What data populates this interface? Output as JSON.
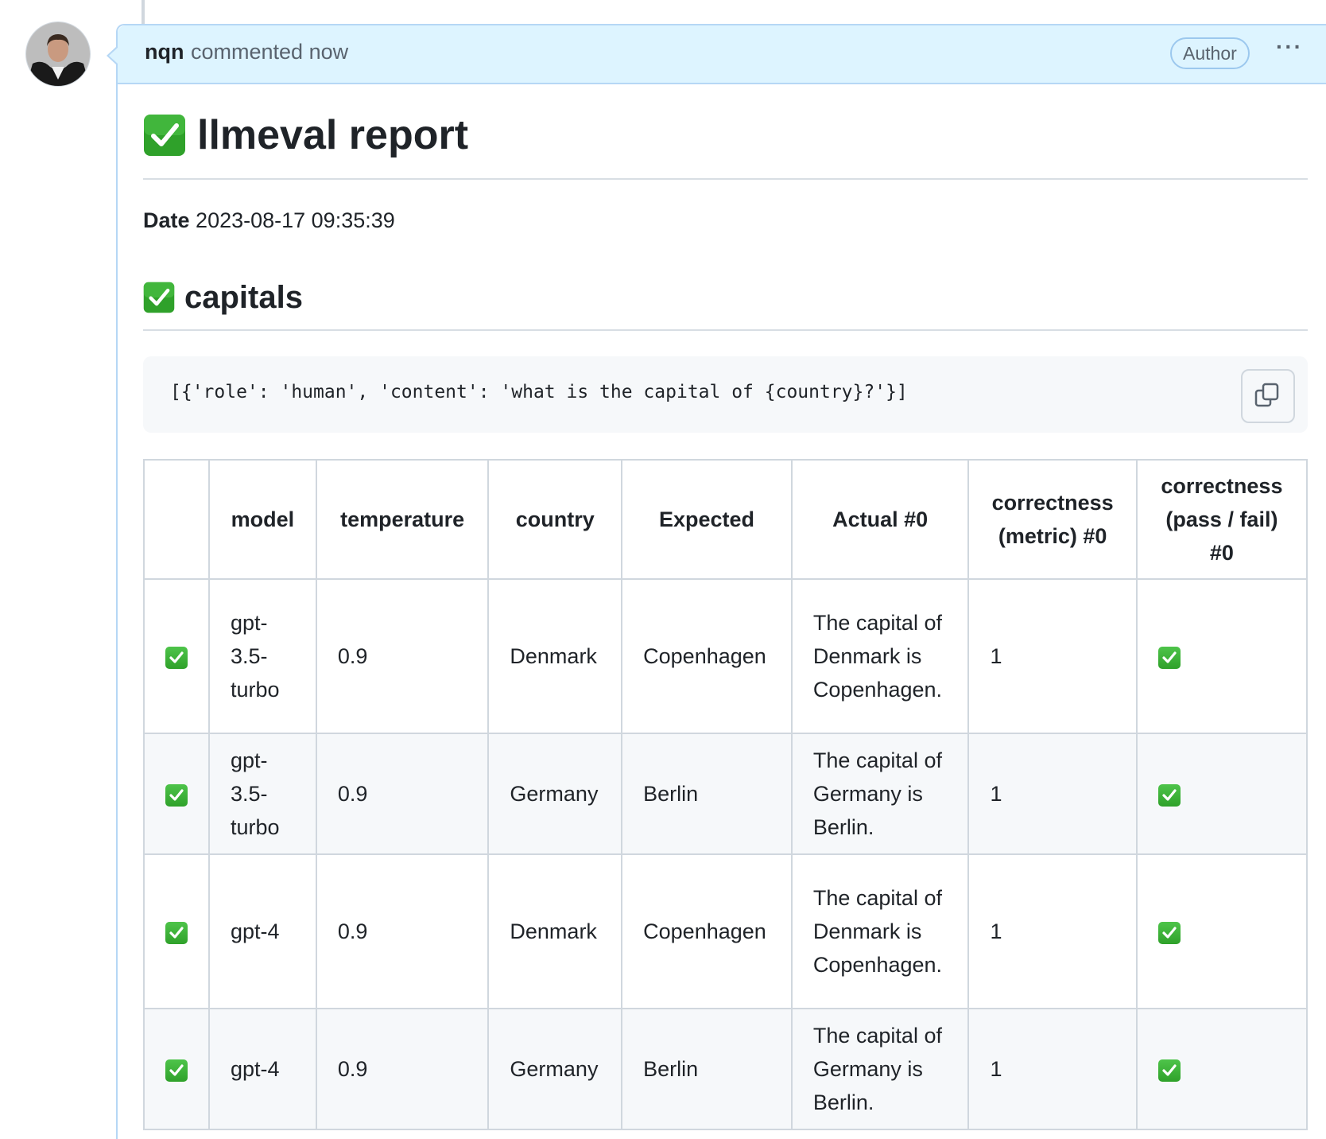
{
  "comment": {
    "author": "nqn",
    "action": "commented now",
    "badge": "Author",
    "more_label": "···"
  },
  "report": {
    "title": "llmeval report",
    "date_label": "Date",
    "date_value": "2023-08-17 09:35:39",
    "section_title": "capitals",
    "prompt_code": "[{'role': 'human', 'content': 'what is the capital of {country}?'}]"
  },
  "table": {
    "headers": {
      "status": "",
      "model": "model",
      "temperature": "temperature",
      "country": "country",
      "expected": "Expected",
      "actual": "Actual #0",
      "metric": "correctness (metric) #0",
      "pass": "correctness (pass / fail) #0"
    },
    "rows": [
      {
        "model": "gpt-3.5-turbo",
        "temperature": "0.9",
        "country": "Denmark",
        "expected": "Copenhagen",
        "actual": "The capital of Denmark is Copenhagen.",
        "metric": "1"
      },
      {
        "model": "gpt-3.5-turbo",
        "temperature": "0.9",
        "country": "Germany",
        "expected": "Berlin",
        "actual": "The capital of Germany is Berlin.",
        "metric": "1"
      },
      {
        "model": "gpt-4",
        "temperature": "0.9",
        "country": "Denmark",
        "expected": "Copenhagen",
        "actual": "The capital of Denmark is Copenhagen.",
        "metric": "1"
      },
      {
        "model": "gpt-4",
        "temperature": "0.9",
        "country": "Germany",
        "expected": "Berlin",
        "actual": "The capital of Germany is Berlin.",
        "metric": "1"
      }
    ]
  },
  "icons": {
    "status_check": "white-heavy-check-mark-icon",
    "copy": "copy-icon",
    "more": "kebab-horizontal-icon"
  },
  "colors": {
    "header_bg": "#ddf4ff",
    "header_border": "#b6d7f5",
    "check_green": "#3fb134",
    "alt_row": "#f6f8fa"
  }
}
